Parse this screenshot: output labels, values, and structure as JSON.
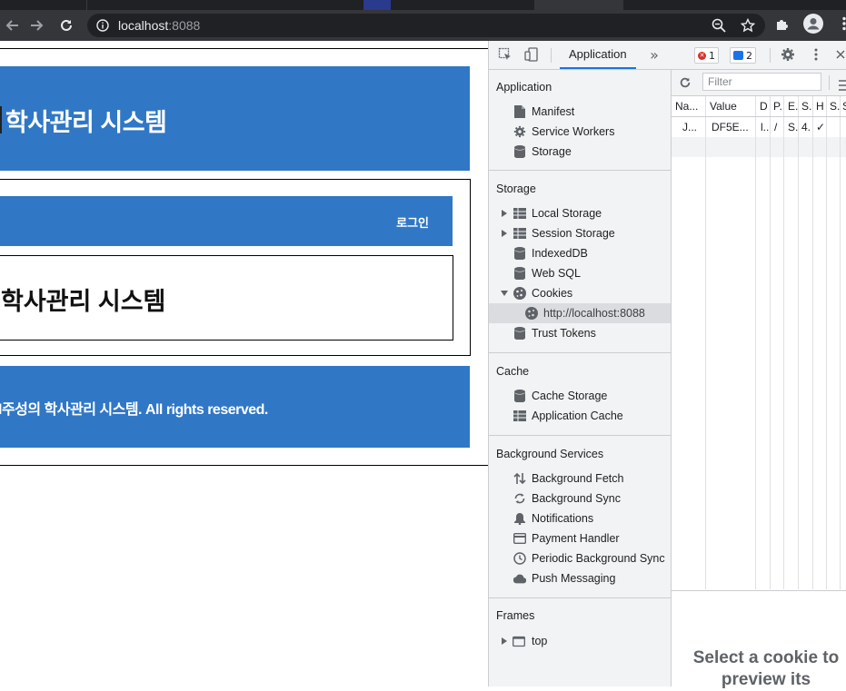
{
  "browser": {
    "url_host": "localhost",
    "url_port": ":8088"
  },
  "page": {
    "header_title": "학사관리 시스템",
    "login_label": "로그인",
    "content_title": "학사관리 시스템",
    "footer_text": "l주성의 학사관리 시스템. All rights reserved."
  },
  "devtools": {
    "active_tab": "Application",
    "more_tabs": "»",
    "error_count": "1",
    "message_count": "2",
    "sidebar": {
      "application_heading": "Application",
      "application_items": [
        "Manifest",
        "Service Workers",
        "Storage"
      ],
      "storage_heading": "Storage",
      "storage_items": [
        "Local Storage",
        "Session Storage",
        "IndexedDB",
        "Web SQL",
        "Cookies",
        "http://localhost:8088",
        "Trust Tokens"
      ],
      "cache_heading": "Cache",
      "cache_items": [
        "Cache Storage",
        "Application Cache"
      ],
      "background_heading": "Background Services",
      "background_items": [
        "Background Fetch",
        "Background Sync",
        "Notifications",
        "Payment Handler",
        "Periodic Background Sync",
        "Push Messaging"
      ],
      "frames_heading": "Frames",
      "frames_items": [
        "top"
      ]
    },
    "filter_placeholder": "Filter",
    "table": {
      "headers": [
        "Na...",
        "Value",
        "D",
        "P.",
        "E.",
        "S.",
        "H",
        "S.",
        "S"
      ],
      "row": [
        "J...",
        "DF5E...",
        "l...",
        "/",
        "S.",
        "4.",
        "✓",
        "",
        ""
      ]
    },
    "preview_text": "Select a cookie to preview its"
  }
}
